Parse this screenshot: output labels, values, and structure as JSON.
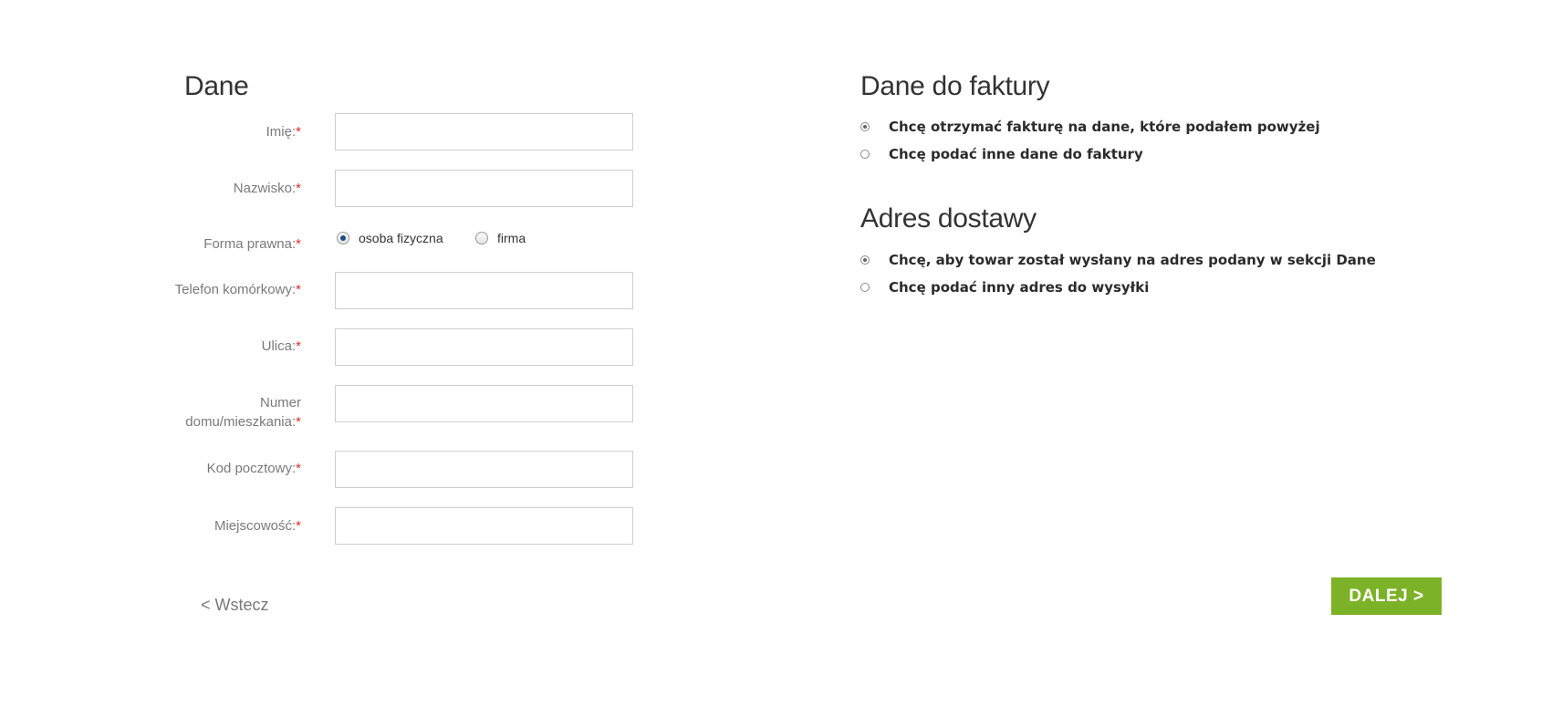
{
  "dane": {
    "title": "Dane",
    "required_mark": "*",
    "fields": {
      "imie": {
        "label": "Imię:",
        "value": ""
      },
      "nazwisko": {
        "label": "Nazwisko:",
        "value": ""
      },
      "forma_prawna": {
        "label": "Forma prawna:",
        "options": [
          "osoba fizyczna",
          "firma"
        ],
        "selected": "osoba fizyczna"
      },
      "telefon": {
        "label": "Telefon komórkowy:",
        "value": ""
      },
      "ulica": {
        "label": "Ulica:",
        "value": ""
      },
      "numer_line1": "Numer",
      "numer_line2": "domu/mieszkania:",
      "numer": {
        "value": ""
      },
      "kod": {
        "label": "Kod pocztowy:",
        "value": ""
      },
      "miejscowosc": {
        "label": "Miejscowość:",
        "value": ""
      }
    }
  },
  "faktura": {
    "title": "Dane do faktury",
    "options": [
      {
        "label": "Chcę otrzymać fakturę na dane, które podałem powyżej",
        "checked": true
      },
      {
        "label": "Chcę podać inne dane do faktury",
        "checked": false
      }
    ]
  },
  "dostawa": {
    "title": "Adres dostawy",
    "options": [
      {
        "label": "Chcę, aby towar został wysłany na adres podany w sekcji Dane",
        "checked": true
      },
      {
        "label": "Chcę podać inny adres do wysyłki",
        "checked": false
      }
    ]
  },
  "nav": {
    "back_label": "< Wstecz",
    "next_label": "DALEJ >"
  },
  "colors": {
    "accent": "#7cb227",
    "required": "#e02b27",
    "label": "#7a7a7a"
  }
}
